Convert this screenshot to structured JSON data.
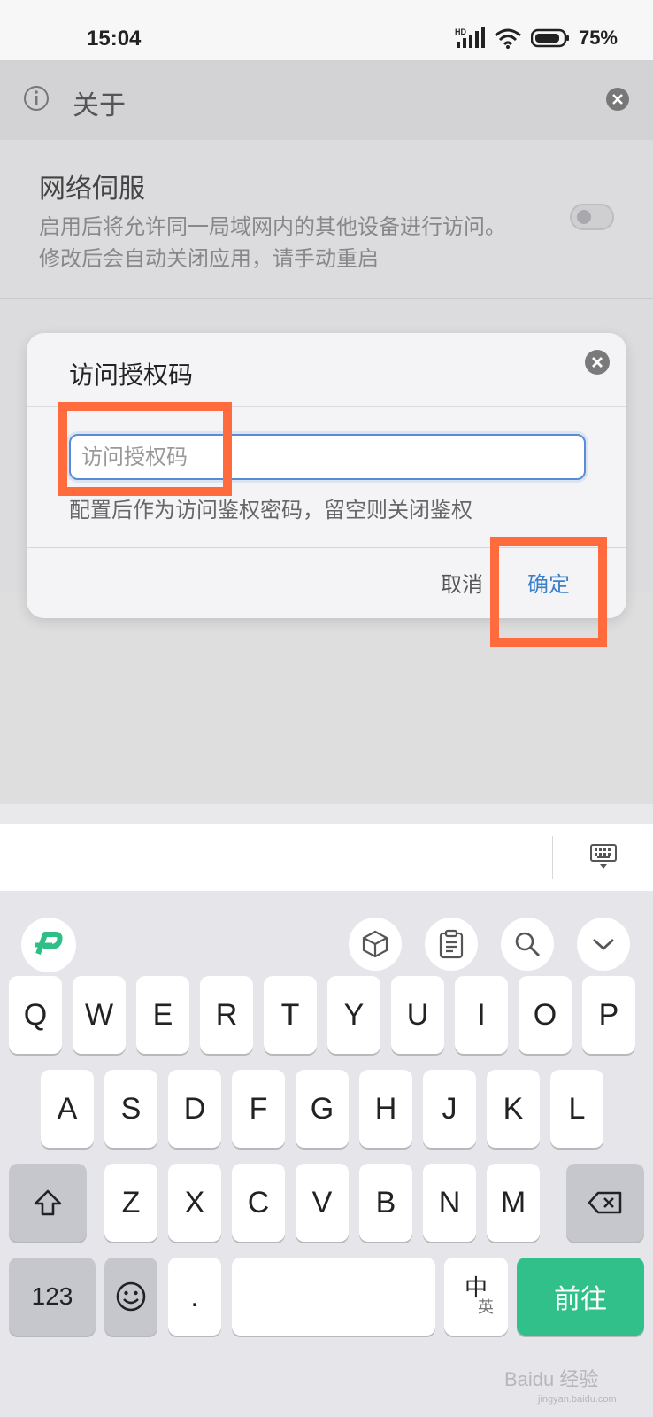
{
  "status": {
    "time": "15:04",
    "network": "HD",
    "battery": "75%"
  },
  "about": {
    "title": "关于"
  },
  "setting": {
    "title": "网络伺服",
    "desc_line1": "启用后将允许同一局域网内的其他设备进行访问。",
    "desc_line2": "修改后会自动关闭应用，请手动重启",
    "toggle_on": false
  },
  "dialog": {
    "title": "访问授权码",
    "input_placeholder": "访问授权码",
    "input_value": "",
    "hint": "配置后作为访问鉴权密码，留空则关闭鉴权",
    "cancel_label": "取消",
    "ok_label": "确定"
  },
  "colors": {
    "highlight": "#ff6b3d",
    "accent": "#3d7fc9",
    "go_key": "#31c08a"
  },
  "keyboard": {
    "toolbar_icons": [
      "ime-logo-icon",
      "cube-icon",
      "clipboard-icon",
      "search-icon",
      "chevron-down-icon"
    ],
    "row1": [
      "Q",
      "W",
      "E",
      "R",
      "T",
      "Y",
      "U",
      "I",
      "O",
      "P"
    ],
    "row2": [
      "A",
      "S",
      "D",
      "F",
      "G",
      "H",
      "J",
      "K",
      "L"
    ],
    "row3": [
      "Z",
      "X",
      "C",
      "V",
      "B",
      "N",
      "M"
    ],
    "num_label": "123",
    "period_label": ".",
    "lang_primary": "中",
    "lang_secondary": "英",
    "go_label": "前往"
  },
  "watermark": {
    "text": "Baidu 经验",
    "url": "jingyan.baidu.com"
  }
}
